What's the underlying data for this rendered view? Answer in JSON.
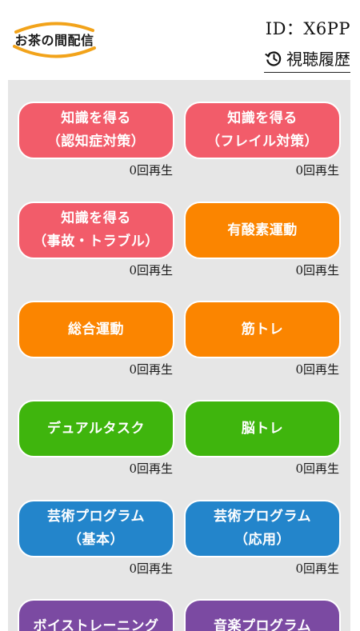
{
  "header": {
    "logo_text": "お茶の間配信",
    "user_id": "ID：X6PP",
    "history_label": "視聴履歴"
  },
  "colors": {
    "red": "#f25c6a",
    "orange": "#fb8500",
    "green": "#3fb50d",
    "blue": "#2385cb",
    "purple": "#7b4aa2",
    "logo_ring": "#f2a31a"
  },
  "programs": [
    {
      "line1": "知識を得る",
      "line2": "（認知症対策）",
      "count": "0回再生",
      "color": "red"
    },
    {
      "line1": "知識を得る",
      "line2": "（フレイル対策）",
      "count": "0回再生",
      "color": "red"
    },
    {
      "line1": "知識を得る",
      "line2": "（事故・トラブル）",
      "count": "0回再生",
      "color": "red"
    },
    {
      "line1": "有酸素運動",
      "line2": "",
      "count": "0回再生",
      "color": "orange"
    },
    {
      "line1": "総合運動",
      "line2": "",
      "count": "0回再生",
      "color": "orange"
    },
    {
      "line1": "筋トレ",
      "line2": "",
      "count": "0回再生",
      "color": "orange"
    },
    {
      "line1": "デュアルタスク",
      "line2": "",
      "count": "0回再生",
      "color": "green"
    },
    {
      "line1": "脳トレ",
      "line2": "",
      "count": "0回再生",
      "color": "green"
    },
    {
      "line1": "芸術プログラム",
      "line2": "（基本）",
      "count": "0回再生",
      "color": "blue"
    },
    {
      "line1": "芸術プログラム",
      "line2": "（応用）",
      "count": "0回再生",
      "color": "blue"
    },
    {
      "line1": "ボイストレーニング",
      "line2": "",
      "count": "",
      "color": "purple"
    },
    {
      "line1": "音楽プログラム",
      "line2": "",
      "count": "",
      "color": "purple"
    }
  ]
}
